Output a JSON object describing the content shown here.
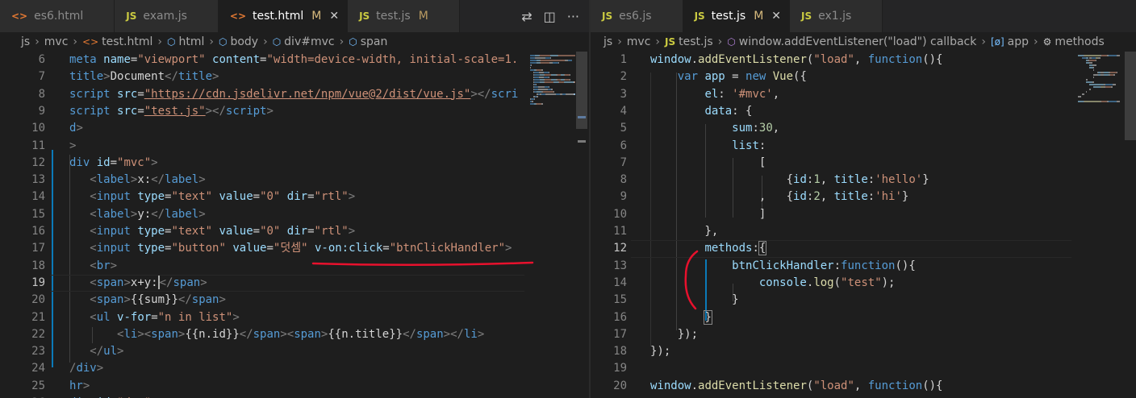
{
  "left": {
    "tabs": [
      {
        "label": "es6.html",
        "icon": "html-file-icon",
        "modified": false,
        "active": false
      },
      {
        "label": "exam.js",
        "icon": "js-file-icon",
        "modified": false,
        "active": false
      },
      {
        "label": "test.html",
        "icon": "html-file-icon",
        "modified": true,
        "active": true
      },
      {
        "label": "test.js",
        "icon": "js-file-icon",
        "modified": true,
        "active": false
      }
    ],
    "modified_marker": "M",
    "close_glyph": "✕",
    "breadcrumb": [
      "js",
      "mvc",
      "test.html",
      "html",
      "body",
      "div#mvc",
      "span"
    ],
    "lines": [
      {
        "n": "6",
        "tokens": [
          [
            "t-tag",
            "meta "
          ],
          [
            "t-attr",
            "name"
          ],
          [
            "t-txt",
            "="
          ],
          [
            "t-str",
            "\"viewport\" "
          ],
          [
            "t-attr",
            "content"
          ],
          [
            "t-txt",
            "="
          ],
          [
            "t-str",
            "\"width=device-width, initial-scale=1."
          ]
        ]
      },
      {
        "n": "7",
        "tokens": [
          [
            "t-tag",
            "title"
          ],
          [
            "t-br",
            ">"
          ],
          [
            "t-txt",
            "Document"
          ],
          [
            "t-br",
            "</"
          ],
          [
            "t-tag",
            "title"
          ],
          [
            "t-br",
            ">"
          ]
        ]
      },
      {
        "n": "8",
        "tokens": [
          [
            "t-tag",
            "script "
          ],
          [
            "t-attr",
            "src"
          ],
          [
            "t-txt",
            "="
          ],
          [
            "t-str u",
            "\"https://cdn.jsdelivr.net/npm/vue@2/dist/vue.js\""
          ],
          [
            "t-br",
            "></"
          ],
          [
            "t-tag",
            "scri"
          ]
        ]
      },
      {
        "n": "9",
        "tokens": [
          [
            "t-tag",
            "script "
          ],
          [
            "t-attr",
            "src"
          ],
          [
            "t-txt",
            "="
          ],
          [
            "t-str u",
            "\"test.js\""
          ],
          [
            "t-br",
            "></"
          ],
          [
            "t-tag",
            "script"
          ],
          [
            "t-br",
            ">"
          ]
        ]
      },
      {
        "n": "10",
        "tokens": [
          [
            "t-tag",
            "d"
          ],
          [
            "t-br",
            ">"
          ]
        ]
      },
      {
        "n": "11",
        "tokens": [
          [
            "t-br",
            ">"
          ]
        ]
      },
      {
        "n": "12",
        "tokens": [
          [
            "t-tag",
            "div "
          ],
          [
            "t-attr",
            "id"
          ],
          [
            "t-txt",
            "="
          ],
          [
            "t-str",
            "\"mvc\""
          ],
          [
            "t-br",
            ">"
          ]
        ]
      },
      {
        "n": "13",
        "tokens": [
          [
            "t-txt",
            "   "
          ],
          [
            "t-br",
            "<"
          ],
          [
            "t-tag",
            "label"
          ],
          [
            "t-br",
            ">"
          ],
          [
            "t-txt",
            "x:"
          ],
          [
            "t-br",
            "</"
          ],
          [
            "t-tag",
            "label"
          ],
          [
            "t-br",
            ">"
          ]
        ]
      },
      {
        "n": "14",
        "tokens": [
          [
            "t-txt",
            "   "
          ],
          [
            "t-br",
            "<"
          ],
          [
            "t-tag",
            "input "
          ],
          [
            "t-attr",
            "type"
          ],
          [
            "t-txt",
            "="
          ],
          [
            "t-str",
            "\"text\" "
          ],
          [
            "t-attr",
            "value"
          ],
          [
            "t-txt",
            "="
          ],
          [
            "t-str",
            "\"0\" "
          ],
          [
            "t-attr",
            "dir"
          ],
          [
            "t-txt",
            "="
          ],
          [
            "t-str",
            "\"rtl\""
          ],
          [
            "t-br",
            ">"
          ]
        ]
      },
      {
        "n": "15",
        "tokens": [
          [
            "t-txt",
            "   "
          ],
          [
            "t-br",
            "<"
          ],
          [
            "t-tag",
            "label"
          ],
          [
            "t-br",
            ">"
          ],
          [
            "t-txt",
            "y:"
          ],
          [
            "t-br",
            "</"
          ],
          [
            "t-tag",
            "label"
          ],
          [
            "t-br",
            ">"
          ]
        ]
      },
      {
        "n": "16",
        "tokens": [
          [
            "t-txt",
            "   "
          ],
          [
            "t-br",
            "<"
          ],
          [
            "t-tag",
            "input "
          ],
          [
            "t-attr",
            "type"
          ],
          [
            "t-txt",
            "="
          ],
          [
            "t-str",
            "\"text\" "
          ],
          [
            "t-attr",
            "value"
          ],
          [
            "t-txt",
            "="
          ],
          [
            "t-str",
            "\"0\" "
          ],
          [
            "t-attr",
            "dir"
          ],
          [
            "t-txt",
            "="
          ],
          [
            "t-str",
            "\"rtl\""
          ],
          [
            "t-br",
            ">"
          ]
        ]
      },
      {
        "n": "17",
        "tokens": [
          [
            "t-txt",
            "   "
          ],
          [
            "t-br",
            "<"
          ],
          [
            "t-tag",
            "input "
          ],
          [
            "t-attr",
            "type"
          ],
          [
            "t-txt",
            "="
          ],
          [
            "t-str",
            "\"button\" "
          ],
          [
            "t-attr",
            "value"
          ],
          [
            "t-txt",
            "="
          ],
          [
            "t-str",
            "\"덧셈\" "
          ],
          [
            "t-attr",
            "v-on:click"
          ],
          [
            "t-txt",
            "="
          ],
          [
            "t-str",
            "\"btnClickHandler\""
          ],
          [
            "t-br",
            ">"
          ]
        ]
      },
      {
        "n": "18",
        "tokens": [
          [
            "t-txt",
            "   "
          ],
          [
            "t-br",
            "<"
          ],
          [
            "t-tag",
            "br"
          ],
          [
            "t-br",
            ">"
          ]
        ]
      },
      {
        "n": "19",
        "tokens": [
          [
            "t-txt",
            "   "
          ],
          [
            "t-br",
            "<"
          ],
          [
            "t-tag",
            "span"
          ],
          [
            "t-br",
            ">"
          ],
          [
            "t-txt",
            "x+y:"
          ],
          [
            "cursor",
            ""
          ],
          [
            "t-br",
            "</"
          ],
          [
            "t-tag",
            "span"
          ],
          [
            "t-br",
            ">"
          ]
        ]
      },
      {
        "n": "20",
        "tokens": [
          [
            "t-txt",
            "   "
          ],
          [
            "t-br",
            "<"
          ],
          [
            "t-tag",
            "span"
          ],
          [
            "t-br",
            ">"
          ],
          [
            "t-txt",
            "{{sum}}"
          ],
          [
            "t-br",
            "</"
          ],
          [
            "t-tag",
            "span"
          ],
          [
            "t-br",
            ">"
          ]
        ]
      },
      {
        "n": "21",
        "tokens": [
          [
            "t-txt",
            "   "
          ],
          [
            "t-br",
            "<"
          ],
          [
            "t-tag",
            "ul "
          ],
          [
            "t-attr",
            "v-for"
          ],
          [
            "t-txt",
            "="
          ],
          [
            "t-str",
            "\"n in list\""
          ],
          [
            "t-br",
            ">"
          ]
        ]
      },
      {
        "n": "22",
        "tokens": [
          [
            "t-txt",
            "       "
          ],
          [
            "t-br",
            "<"
          ],
          [
            "t-tag",
            "li"
          ],
          [
            "t-br",
            "><"
          ],
          [
            "t-tag",
            "span"
          ],
          [
            "t-br",
            ">"
          ],
          [
            "t-txt",
            "{{n.id}}"
          ],
          [
            "t-br",
            "</"
          ],
          [
            "t-tag",
            "span"
          ],
          [
            "t-br",
            "><"
          ],
          [
            "t-tag",
            "span"
          ],
          [
            "t-br",
            ">"
          ],
          [
            "t-txt",
            "{{n.title}}"
          ],
          [
            "t-br",
            "</"
          ],
          [
            "t-tag",
            "span"
          ],
          [
            "t-br",
            "></"
          ],
          [
            "t-tag",
            "li"
          ],
          [
            "t-br",
            ">"
          ]
        ]
      },
      {
        "n": "23",
        "tokens": [
          [
            "t-txt",
            "   "
          ],
          [
            "t-br",
            "</"
          ],
          [
            "t-tag",
            "ul"
          ],
          [
            "t-br",
            ">"
          ]
        ]
      },
      {
        "n": "24",
        "tokens": [
          [
            "t-br",
            "/"
          ],
          [
            "t-tag",
            "div"
          ],
          [
            "t-br",
            ">"
          ]
        ]
      },
      {
        "n": "25",
        "tokens": [
          [
            "t-tag",
            "hr"
          ],
          [
            "t-br",
            ">"
          ]
        ]
      },
      {
        "n": "26",
        "tokens": [
          [
            "t-tag",
            "div "
          ],
          [
            "t-attr",
            "id"
          ],
          [
            "t-txt",
            "="
          ],
          [
            "t-str",
            "\"dom\""
          ],
          [
            "t-br",
            ">"
          ]
        ]
      }
    ],
    "current_line": "19"
  },
  "right": {
    "tabs": [
      {
        "label": "es6.js",
        "icon": "js-file-icon",
        "modified": false,
        "active": false
      },
      {
        "label": "test.js",
        "icon": "js-file-icon",
        "modified": true,
        "active": true
      },
      {
        "label": "ex1.js",
        "icon": "js-file-icon",
        "modified": false,
        "active": false
      }
    ],
    "breadcrumb": [
      "js",
      "mvc",
      "test.js",
      "window.addEventListener(\"load\") callback",
      "app",
      "methods"
    ],
    "lines": [
      {
        "n": "1",
        "tokens": [
          [
            "t-var",
            "window"
          ],
          [
            "t-pun",
            "."
          ],
          [
            "t-fn",
            "addEventListener"
          ],
          [
            "t-pun",
            "("
          ],
          [
            "t-str",
            "\"load\""
          ],
          [
            "t-pun",
            ", "
          ],
          [
            "t-kw",
            "function"
          ],
          [
            "t-pun",
            "(){"
          ]
        ]
      },
      {
        "n": "2",
        "tokens": [
          [
            "t-pun",
            "    "
          ],
          [
            "t-kw",
            "var "
          ],
          [
            "t-var",
            "app"
          ],
          [
            "t-pun",
            " = "
          ],
          [
            "t-kw",
            "new "
          ],
          [
            "t-fn",
            "Vue"
          ],
          [
            "t-pun",
            "({"
          ]
        ]
      },
      {
        "n": "3",
        "tokens": [
          [
            "t-pun",
            "        "
          ],
          [
            "t-prop",
            "el"
          ],
          [
            "t-pun",
            ": "
          ],
          [
            "t-str",
            "'#mvc'"
          ],
          [
            "t-pun",
            ","
          ]
        ]
      },
      {
        "n": "4",
        "tokens": [
          [
            "t-pun",
            "        "
          ],
          [
            "t-prop",
            "data"
          ],
          [
            "t-pun",
            ": {"
          ]
        ]
      },
      {
        "n": "5",
        "tokens": [
          [
            "t-pun",
            "            "
          ],
          [
            "t-prop",
            "sum"
          ],
          [
            "t-pun",
            ":"
          ],
          [
            "t-num",
            "30"
          ],
          [
            "t-pun",
            ","
          ]
        ]
      },
      {
        "n": "6",
        "tokens": [
          [
            "t-pun",
            "            "
          ],
          [
            "t-prop",
            "list"
          ],
          [
            "t-pun",
            ":"
          ]
        ]
      },
      {
        "n": "7",
        "tokens": [
          [
            "t-pun",
            "                ["
          ]
        ]
      },
      {
        "n": "8",
        "tokens": [
          [
            "t-pun",
            "                    {"
          ],
          [
            "t-prop",
            "id"
          ],
          [
            "t-pun",
            ":"
          ],
          [
            "t-num",
            "1"
          ],
          [
            "t-pun",
            ", "
          ],
          [
            "t-prop",
            "title"
          ],
          [
            "t-pun",
            ":"
          ],
          [
            "t-str",
            "'hello'"
          ],
          [
            "t-pun",
            "}"
          ]
        ]
      },
      {
        "n": "9",
        "tokens": [
          [
            "t-pun",
            "                ,   {"
          ],
          [
            "t-prop",
            "id"
          ],
          [
            "t-pun",
            ":"
          ],
          [
            "t-num",
            "2"
          ],
          [
            "t-pun",
            ", "
          ],
          [
            "t-prop",
            "title"
          ],
          [
            "t-pun",
            ":"
          ],
          [
            "t-str",
            "'hi'"
          ],
          [
            "t-pun",
            "}"
          ]
        ]
      },
      {
        "n": "10",
        "tokens": [
          [
            "t-pun",
            "                ]"
          ]
        ]
      },
      {
        "n": "11",
        "tokens": [
          [
            "t-pun",
            "        },"
          ]
        ]
      },
      {
        "n": "12",
        "tokens": [
          [
            "t-pun",
            "        "
          ],
          [
            "t-prop",
            "methods"
          ],
          [
            "t-pun",
            ":"
          ],
          [
            "box",
            "{"
          ]
        ]
      },
      {
        "n": "13",
        "tokens": [
          [
            "t-pun",
            "            "
          ],
          [
            "t-prop",
            "btnClickHandler"
          ],
          [
            "t-pun",
            ":"
          ],
          [
            "t-kw",
            "function"
          ],
          [
            "t-pun",
            "(){"
          ]
        ]
      },
      {
        "n": "14",
        "tokens": [
          [
            "t-pun",
            "                "
          ],
          [
            "t-var",
            "console"
          ],
          [
            "t-pun",
            "."
          ],
          [
            "t-fn",
            "log"
          ],
          [
            "t-pun",
            "("
          ],
          [
            "t-str",
            "\"test\""
          ],
          [
            "t-pun",
            ");"
          ]
        ]
      },
      {
        "n": "15",
        "tokens": [
          [
            "t-pun",
            "            }"
          ]
        ]
      },
      {
        "n": "16",
        "tokens": [
          [
            "t-pun",
            "        "
          ],
          [
            "box",
            "}"
          ]
        ]
      },
      {
        "n": "17",
        "tokens": [
          [
            "t-pun",
            "    });"
          ]
        ]
      },
      {
        "n": "18",
        "tokens": [
          [
            "t-pun",
            "});"
          ]
        ]
      },
      {
        "n": "19",
        "tokens": []
      },
      {
        "n": "20",
        "tokens": [
          [
            "t-var",
            "window"
          ],
          [
            "t-pun",
            "."
          ],
          [
            "t-fn",
            "addEventListener"
          ],
          [
            "t-pun",
            "("
          ],
          [
            "t-str",
            "\"load\""
          ],
          [
            "t-pun",
            ", "
          ],
          [
            "t-kw",
            "function"
          ],
          [
            "t-pun",
            "(){"
          ]
        ]
      }
    ],
    "current_line": "12"
  },
  "colors": {
    "annotation": "#e8112d",
    "guide_active": "#0b7ab8",
    "modified": "#d7ba7d"
  }
}
